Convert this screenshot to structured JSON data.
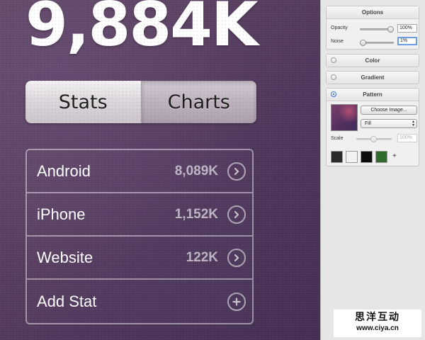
{
  "hero": {
    "total": "9,884K"
  },
  "segmented": {
    "stats_label": "Stats",
    "charts_label": "Charts"
  },
  "stats": [
    {
      "label": "Android",
      "value": "8,089K",
      "action_icon": "chevron-right-circle-icon"
    },
    {
      "label": "iPhone",
      "value": "1,152K",
      "action_icon": "chevron-right-circle-icon"
    },
    {
      "label": "Website",
      "value": "122K",
      "action_icon": "chevron-right-circle-icon"
    },
    {
      "label": "Add Stat",
      "value": "",
      "action_icon": "plus-circle-icon"
    }
  ],
  "panel": {
    "options": {
      "title": "Options",
      "opacity_label": "Opacity",
      "opacity_value": "100%",
      "opacity_level": 1.0,
      "noise_label": "Noise",
      "noise_value": "1%",
      "noise_level": 0.01
    },
    "color": {
      "title": "Color",
      "selected": false
    },
    "gradient": {
      "title": "Gradient",
      "selected": false
    },
    "pattern": {
      "title": "Pattern",
      "selected": true,
      "choose_image_label": "Choose Image...",
      "fill_mode": "Fill",
      "scale_label": "Scale",
      "scale_value": "100%",
      "swatches": [
        "#2a2a2a",
        "#f2f2f2",
        "#0c0c0c",
        "#2f6b2a"
      ],
      "add_label": "+"
    }
  },
  "watermark": {
    "line1": "思洋互动",
    "line2": "www.ciya.cn"
  }
}
